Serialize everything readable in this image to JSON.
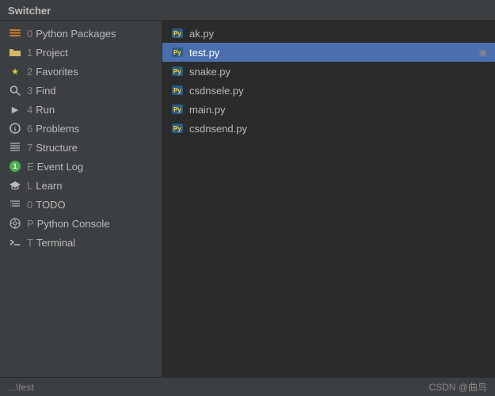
{
  "title": "Switcher",
  "sidebar": {
    "items": [
      {
        "id": "python-packages",
        "shortcut": "0",
        "label": "Python Packages",
        "icon": "layers",
        "icon_char": "⊞"
      },
      {
        "id": "project",
        "shortcut": "1",
        "label": "Project",
        "icon": "folder",
        "icon_char": "📁"
      },
      {
        "id": "favorites",
        "shortcut": "2",
        "label": "Favorites",
        "icon": "star",
        "icon_char": "★"
      },
      {
        "id": "find",
        "shortcut": "3",
        "label": "Find",
        "icon": "search",
        "icon_char": "🔍"
      },
      {
        "id": "run",
        "shortcut": "4",
        "label": "Run",
        "icon": "play",
        "icon_char": "▶"
      },
      {
        "id": "problems",
        "shortcut": "6",
        "label": "Problems",
        "icon": "info",
        "icon_char": "ℹ"
      },
      {
        "id": "structure",
        "shortcut": "7",
        "label": "Structure",
        "icon": "structure",
        "icon_char": "⚌"
      },
      {
        "id": "event-log",
        "shortcut": "E",
        "label": "Event Log",
        "icon": "event",
        "icon_char": "E",
        "badge": "1"
      },
      {
        "id": "learn",
        "shortcut": "L",
        "label": "Learn",
        "icon": "learn",
        "icon_char": "🎓"
      },
      {
        "id": "todo",
        "shortcut": "0",
        "label": "TODO",
        "icon": "todo",
        "icon_char": "☰"
      },
      {
        "id": "python-console",
        "shortcut": "P",
        "label": "Python Console",
        "icon": "console",
        "icon_char": "⚙"
      },
      {
        "id": "terminal",
        "shortcut": "T",
        "label": "Terminal",
        "icon": "terminal",
        "icon_char": "▷"
      }
    ]
  },
  "files": {
    "items": [
      {
        "id": "ak-py",
        "name": "ak.py",
        "selected": false,
        "pinned": false
      },
      {
        "id": "test-py",
        "name": "test.py",
        "selected": true,
        "pinned": true
      },
      {
        "id": "snake-py",
        "name": "snake.py",
        "selected": false,
        "pinned": false
      },
      {
        "id": "csdnsele-py",
        "name": "csdnsele.py",
        "selected": false,
        "pinned": false
      },
      {
        "id": "main-py",
        "name": "main.py",
        "selected": false,
        "pinned": false
      },
      {
        "id": "csdnsend-py",
        "name": "csdnsend.py",
        "selected": false,
        "pinned": false
      }
    ]
  },
  "status_bar": {
    "path": "...\\test",
    "branding": "CSDN @曲鸟"
  }
}
